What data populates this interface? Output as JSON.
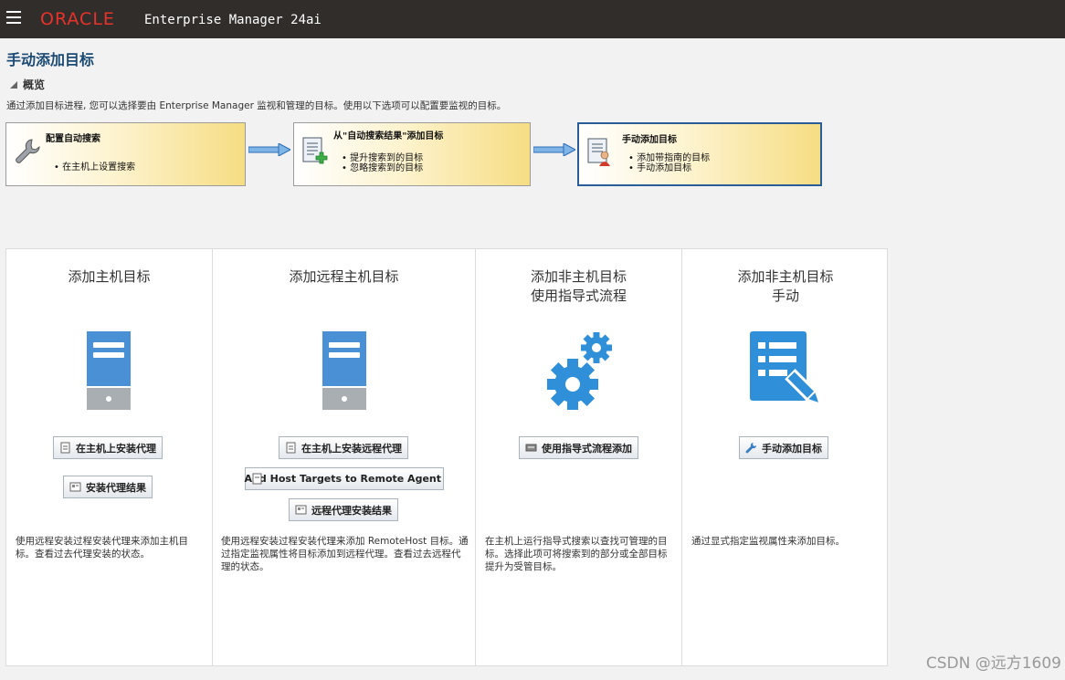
{
  "header": {
    "menu_icon": "hamburger-icon",
    "brand": "ORACLE",
    "product": "Enterprise Manager 24ai"
  },
  "page": {
    "title": "手动添加目标",
    "section_label": "概览",
    "description": "通过添加目标进程, 您可以选择要由 Enterprise Manager 监视和管理的目标。使用以下选项可以配置要监视的目标。"
  },
  "flow": [
    {
      "title": "配置自动搜索",
      "items": [
        "在主机上设置搜索"
      ],
      "icon": "wrench-icon",
      "active": false
    },
    {
      "title": "从\"自动搜索结果\"添加目标",
      "items": [
        "提升搜索到的目标",
        "忽略搜索到的目标"
      ],
      "icon": "add-list-icon",
      "active": false
    },
    {
      "title": "手动添加目标",
      "items": [
        "添加带指南的目标",
        "手动添加目标"
      ],
      "icon": "manual-target-icon",
      "active": true
    }
  ],
  "cards": [
    {
      "title": "添加主机目标",
      "icon": "server-icon",
      "buttons": [
        "在主机上安装代理",
        "安装代理结果"
      ],
      "text": "使用远程安装过程安装代理来添加主机目标。查看过去代理安装的状态。"
    },
    {
      "title": "添加远程主机目标",
      "icon": "server-icon",
      "buttons": [
        "在主机上安装远程代理",
        "Add Host Targets to Remote Agent",
        "远程代理安装结果"
      ],
      "text": "使用远程安装过程安装代理来添加 RemoteHost 目标。通过指定监视属性将目标添加到远程代理。查看过去远程代理的状态。"
    },
    {
      "title_line1": "添加非主机目标",
      "title_line2": "使用指导式流程",
      "icon": "gears-icon",
      "buttons": [
        "使用指导式流程添加"
      ],
      "text": "在主机上运行指导式搜索以查找可管理的目标。选择此项可将搜索到的部分或全部目标提升为受管目标。"
    },
    {
      "title_line1": "添加非主机目标",
      "title_line2": "手动",
      "icon": "edit-list-icon",
      "buttons": [
        "手动添加目标"
      ],
      "text": "通过显式指定监视属性来添加目标。"
    }
  ],
  "watermark": "CSDN @远方1609",
  "colors": {
    "topbar": "#312d2a",
    "brand": "#e8322b",
    "title": "#1b4a74",
    "icon_blue": "#4a90d4",
    "icon_gray": "#a9aeb3"
  }
}
